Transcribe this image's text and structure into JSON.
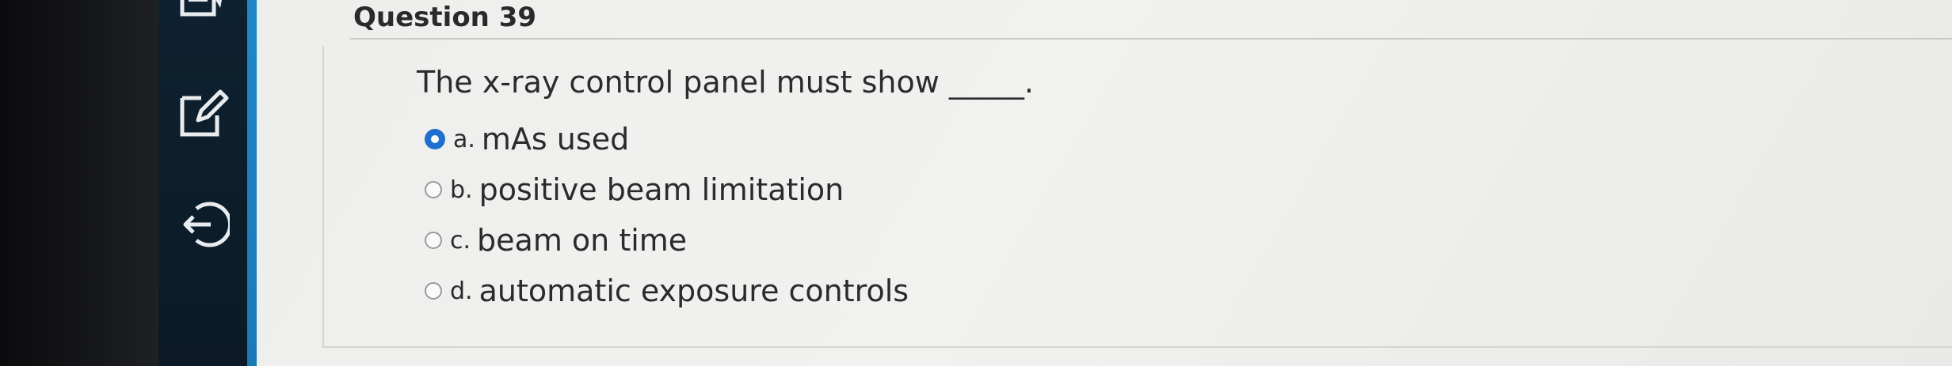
{
  "question": {
    "title": "Question 39",
    "text": "The x-ray control panel must show _____."
  },
  "answers": [
    {
      "letter": "a.",
      "text": "mAs used",
      "selected": true
    },
    {
      "letter": "b.",
      "text": "positive beam limitation",
      "selected": false
    },
    {
      "letter": "c.",
      "text": "beam on time",
      "selected": false
    },
    {
      "letter": "d.",
      "text": "automatic exposure controls",
      "selected": false
    }
  ],
  "rail_icons": [
    "flag-icon",
    "edit-icon",
    "exit-icon"
  ],
  "colors": {
    "rail": "#0e2130",
    "accent": "#1f87c8",
    "radio_selected": "#1e6fd0"
  }
}
